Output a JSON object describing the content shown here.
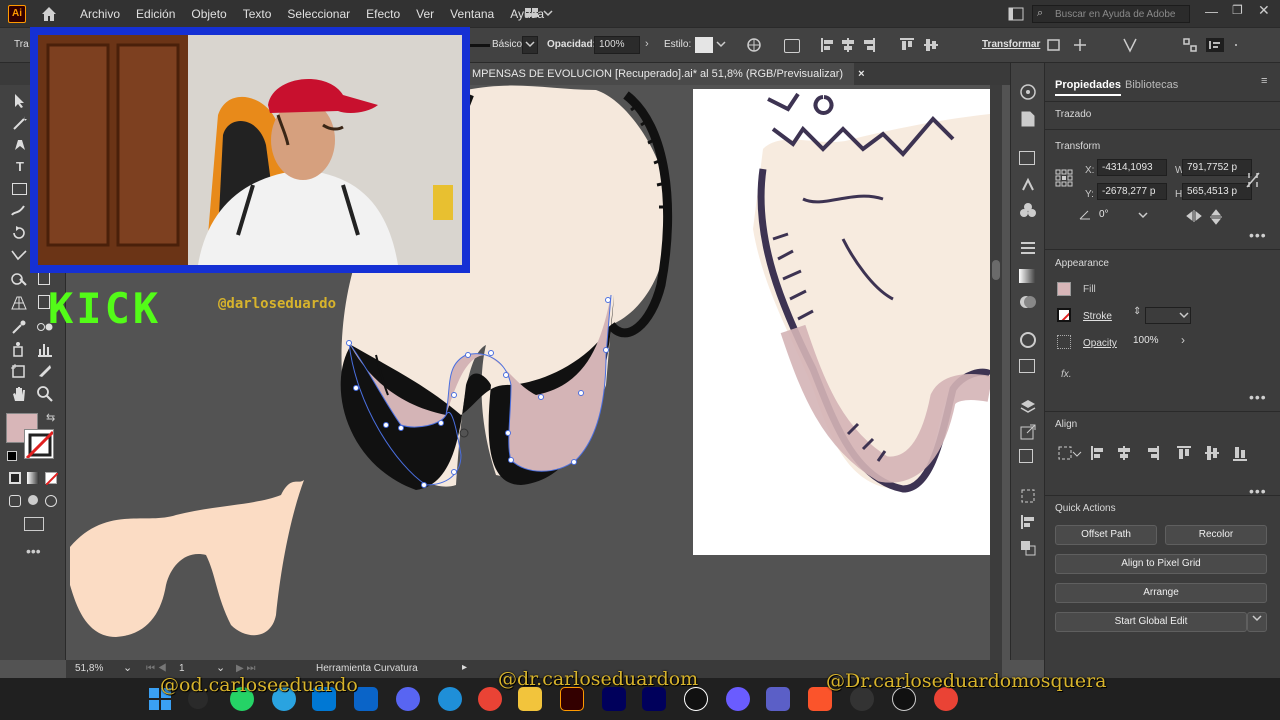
{
  "app": {
    "logo": "Ai"
  },
  "menu": [
    "Archivo",
    "Edición",
    "Objeto",
    "Texto",
    "Seleccionar",
    "Efecto",
    "Ver",
    "Ventana",
    "Ayuda"
  ],
  "search": {
    "placeholder": "Buscar en Ayuda de Adobe"
  },
  "control": {
    "left_label": "Tra",
    "stroke_style": "Básico",
    "opacity_label": "Opacidad:",
    "opacity_value": "100%",
    "style_label": "Estilo:",
    "transform_label": "Transformar"
  },
  "document_tab": {
    "title": "MPENSAS DE EVOLUCION [Recuperado].ai* al 51,8% (RGB/Previsualizar)",
    "close": "×"
  },
  "panel": {
    "tabs": [
      "Propiedades",
      "Bibliotecas"
    ],
    "object_type": "Trazado",
    "transform": {
      "title": "Transform",
      "x_label": "X:",
      "x": "-4314,1093",
      "y_label": "Y:",
      "y": "-2678,277 p",
      "w_label": "W:",
      "w": "791,7752 p",
      "h_label": "H:",
      "h": "565,4513 p",
      "angle": "0°"
    },
    "appearance": {
      "title": "Appearance",
      "fill_label": "Fill",
      "stroke_label": "Stroke",
      "opacity_label": "Opacity",
      "opacity_value": "100%",
      "fx": "fx."
    },
    "align": {
      "title": "Align"
    },
    "quick_actions": {
      "title": "Quick Actions",
      "offset_path": "Offset Path",
      "recolor": "Recolor",
      "align_pixel": "Align to Pixel Grid",
      "arrange": "Arrange",
      "global_edit": "Start Global Edit"
    },
    "more": "•••"
  },
  "status": {
    "zoom": "51,8%",
    "page": "1",
    "tool": "Herramienta Curvatura"
  },
  "overlay": {
    "kick": "KICK",
    "kick_handle": "@darloseduardo",
    "handle1": "@od.carloseeduardo",
    "handle2": "@dr.carloseduardom",
    "handle3": "@Dr.carloseduardomosquera"
  },
  "colors": {
    "fill_swatch": "#d8b6b8",
    "tooth_cream": "#f5e8dc",
    "gum": "#d4b4b6",
    "gum_light": "#fbdcc4",
    "webcam_border": "#1530d4",
    "kick_green": "#53fc18"
  }
}
